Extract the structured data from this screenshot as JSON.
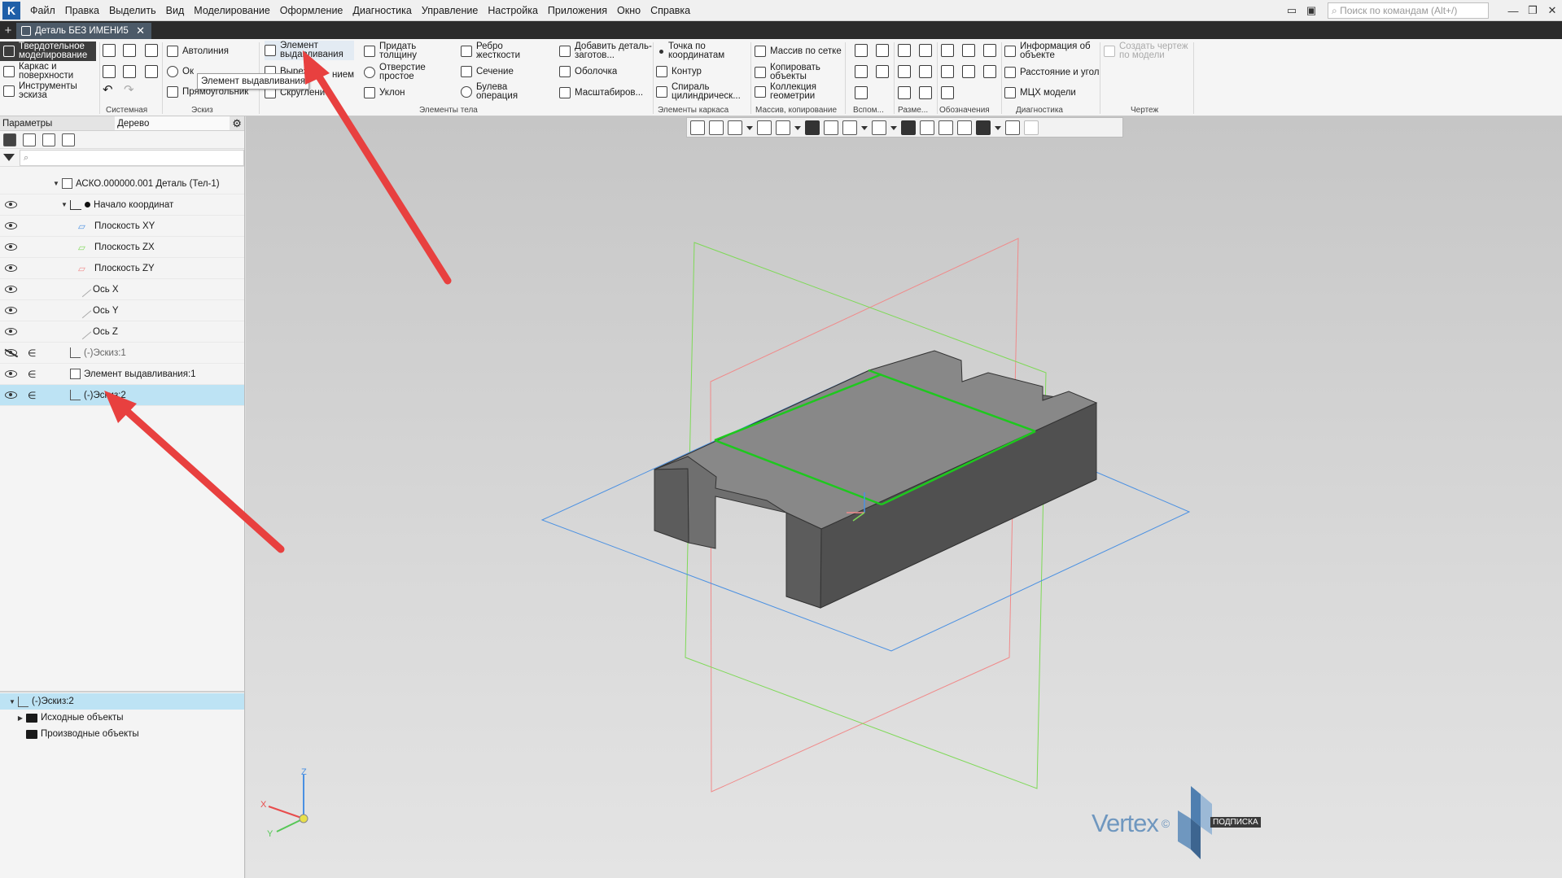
{
  "menubar": {
    "items": [
      "Файл",
      "Правка",
      "Выделить",
      "Вид",
      "Моделирование",
      "Оформление",
      "Диагностика",
      "Управление",
      "Настройка",
      "Приложения",
      "Окно",
      "Справка"
    ],
    "search_placeholder": "Поиск по командам (Alt+/)"
  },
  "tabs": {
    "document": "Деталь БЕЗ ИМЕНИ5"
  },
  "ribbon": {
    "categories": [
      "Твердотельное моделирование",
      "Каркас и поверхности",
      "Инструменты эскиза"
    ],
    "commands": {
      "autoline": "Автолиния",
      "circle": "Ок",
      "rectangle": "Прямоугольник",
      "extrude": "Элемент выдавливания",
      "cut": "Вырезать",
      "rotate_suffix": "нием",
      "fillet": "Скругление",
      "thicken": "Придать толщину",
      "hole": "Отверстие простое",
      "draft": "Уклон",
      "rib": "Ребро жесткости",
      "section": "Сечение",
      "boolean": "Булева операция",
      "add_part": "Добавить деталь-заготов...",
      "shell": "Оболочка",
      "scale": "Масштабиров...",
      "point_coords": "Точка по координатам",
      "contour": "Контур",
      "spiral": "Спираль цилиндрическ...",
      "grid_array": "Массив по сетке",
      "copy_objects": "Копировать объекты",
      "geom_collection": "Коллекция геометрии",
      "object_info": "Информация об объекте",
      "distance_angle": "Расстояние и угол",
      "mcx": "МЦХ модели",
      "create_drawing": "Создать чертеж по модели"
    },
    "groups": [
      "Системная",
      "Эскиз",
      "Элементы тела",
      "Элементы каркаса",
      "Массив, копирование",
      "Вспом...",
      "Разме...",
      "Обозначения",
      "Диагностика",
      "Чертеж"
    ],
    "tooltip": "Элемент выдавливания"
  },
  "panel": {
    "tabs": [
      "Параметры",
      "Дерево"
    ],
    "search_placeholder": "",
    "tree": [
      {
        "label": "АСКО.000000.001 Деталь (Тел-1)",
        "level": 0,
        "eye": false
      },
      {
        "label": "Начало координат",
        "level": 1,
        "eye": true
      },
      {
        "label": "Плоскость XY",
        "level": 2,
        "eye": true
      },
      {
        "label": "Плоскость ZX",
        "level": 2,
        "eye": true
      },
      {
        "label": "Плоскость ZY",
        "level": 2,
        "eye": true
      },
      {
        "label": "Ось X",
        "level": 2,
        "eye": true
      },
      {
        "label": "Ось Y",
        "level": 2,
        "eye": true
      },
      {
        "label": "Ось Z",
        "level": 2,
        "eye": true
      },
      {
        "label": "(-)Эскиз:1",
        "level": 1,
        "eye": true
      },
      {
        "label": "Элемент выдавливания:1",
        "level": 1,
        "eye": true
      },
      {
        "label": "(-)Эскиз:2",
        "level": 1,
        "eye": true
      }
    ],
    "bottom_tree": [
      "(-)Эскиз:2",
      "Исходные объекты",
      "Производные объекты"
    ]
  },
  "viewport": {
    "axis_labels": {
      "x": "X",
      "y": "Y",
      "z": "Z"
    },
    "watermark": "Vertex",
    "watermark_sub": "ПОДПИСКА"
  },
  "colors": {
    "accent": "#bde3f4",
    "annotation_arrow": "#e8403f",
    "plane_xy": "#4a90e2",
    "plane_zx": "#7ed957",
    "plane_zy": "#f08a8a",
    "sketch": "#1ec81e"
  }
}
